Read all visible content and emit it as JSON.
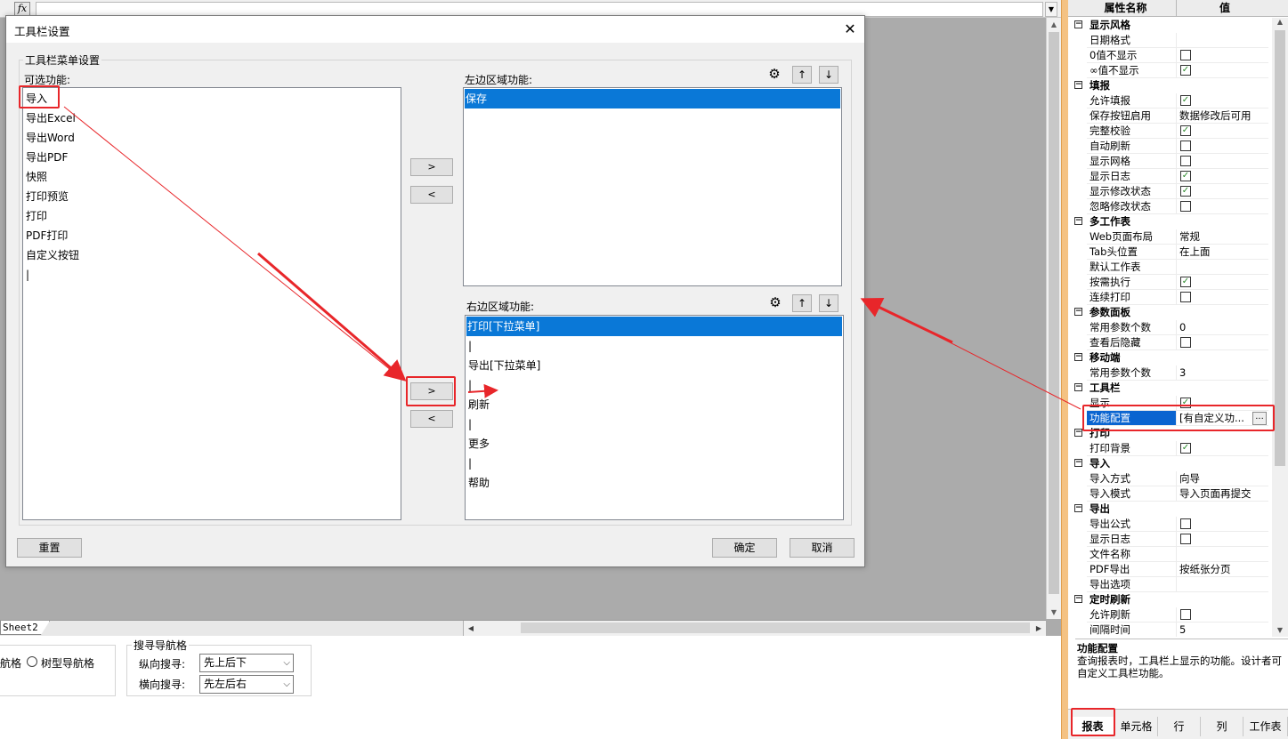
{
  "formula_bar": {
    "fx_label": "fx"
  },
  "sheet_tab": "Sheet2",
  "bottom_panel": {
    "grid_nav_label": "航格",
    "tree_nav_label": "树型导航格",
    "search_nav_title": "搜寻导航格",
    "vertical_search_label": "纵向搜寻:",
    "vertical_search_value": "先上后下",
    "horizontal_search_label": "横向搜寻:",
    "horizontal_search_value": "先左后右"
  },
  "dialog": {
    "title": "工具栏设置",
    "close_glyph": "✕",
    "group_title": "工具栏菜单设置",
    "available_label": "可选功能:",
    "available_items": [
      "导入",
      "导出Excel",
      "导出Word",
      "导出PDF",
      "快照",
      "打印预览",
      "打印",
      "PDF打印",
      "自定义按钮",
      "|"
    ],
    "left_area_label": "左边区域功能:",
    "left_area_items": [
      "保存"
    ],
    "right_area_label": "右边区域功能:",
    "right_area_items": [
      "打印[下拉菜单]",
      "|",
      "导出[下拉菜单]",
      "|",
      "刷新",
      "|",
      "更多",
      "|",
      "帮助"
    ],
    "move_right_label": ">",
    "move_left_label": "<",
    "up_label": "↑",
    "down_label": "↓",
    "gear_glyph": "⚙",
    "reset_label": "重置",
    "ok_label": "确定",
    "cancel_label": "取消"
  },
  "properties": {
    "header_name": "属性名称",
    "header_value": "值",
    "rows": [
      {
        "kind": "cat",
        "label": "显示风格"
      },
      {
        "kind": "item",
        "label": "日期格式",
        "value": ""
      },
      {
        "kind": "item",
        "label": "0值不显示",
        "check": false
      },
      {
        "kind": "item",
        "label": "∞值不显示",
        "check": true
      },
      {
        "kind": "cat",
        "label": "填报"
      },
      {
        "kind": "item",
        "label": "允许填报",
        "check": true
      },
      {
        "kind": "item",
        "label": "保存按钮启用",
        "value": "数据修改后可用"
      },
      {
        "kind": "item",
        "label": "完整校验",
        "check": true
      },
      {
        "kind": "item",
        "label": "自动刷新",
        "check": false
      },
      {
        "kind": "item",
        "label": "显示网格",
        "check": false
      },
      {
        "kind": "item",
        "label": "显示日志",
        "check": true
      },
      {
        "kind": "item",
        "label": "显示修改状态",
        "check": true
      },
      {
        "kind": "item",
        "label": "忽略修改状态",
        "check": false
      },
      {
        "kind": "cat",
        "label": "多工作表"
      },
      {
        "kind": "item",
        "label": "Web页面布局",
        "value": "常规"
      },
      {
        "kind": "item",
        "label": "Tab头位置",
        "value": "在上面"
      },
      {
        "kind": "item",
        "label": "默认工作表",
        "value": ""
      },
      {
        "kind": "item",
        "label": "按需执行",
        "check": true
      },
      {
        "kind": "item",
        "label": "连续打印",
        "check": false
      },
      {
        "kind": "cat",
        "label": "参数面板"
      },
      {
        "kind": "item",
        "label": "常用参数个数",
        "value": "0"
      },
      {
        "kind": "item",
        "label": "查看后隐藏",
        "check": false
      },
      {
        "kind": "cat",
        "label": "移动端"
      },
      {
        "kind": "item",
        "label": "常用参数个数",
        "value": "3"
      },
      {
        "kind": "cat",
        "label": "工具栏"
      },
      {
        "kind": "item",
        "label": "显示",
        "check": true
      },
      {
        "kind": "item",
        "label": "功能配置",
        "value": "[有自定义功...",
        "selected": true,
        "ellipsis": "..."
      },
      {
        "kind": "cat",
        "label": "打印"
      },
      {
        "kind": "item",
        "label": "打印背景",
        "check": true
      },
      {
        "kind": "cat",
        "label": "导入"
      },
      {
        "kind": "item",
        "label": "导入方式",
        "value": "向导"
      },
      {
        "kind": "item",
        "label": "导入模式",
        "value": "导入页面再提交"
      },
      {
        "kind": "cat",
        "label": "导出"
      },
      {
        "kind": "item",
        "label": "导出公式",
        "check": false
      },
      {
        "kind": "item",
        "label": "显示日志",
        "check": false
      },
      {
        "kind": "item",
        "label": "文件名称",
        "value": ""
      },
      {
        "kind": "item",
        "label": "PDF导出",
        "value": "按纸张分页"
      },
      {
        "kind": "item",
        "label": "导出选项",
        "value": ""
      },
      {
        "kind": "cat",
        "label": "定时刷新"
      },
      {
        "kind": "item",
        "label": "允许刷新",
        "check": false
      },
      {
        "kind": "item",
        "label": "间隔时间",
        "value": "5"
      }
    ],
    "description_title": "功能配置",
    "description_text": "查询报表时，工具栏上显示的功能。设计者可自定义工具栏功能。",
    "tabs": [
      "报表",
      "单元格",
      "行",
      "列",
      "工作表"
    ],
    "active_tab": "报表"
  },
  "colors": {
    "selection": "#0a78d7",
    "annotation": "#e8262a",
    "frame": "#f4c283"
  }
}
